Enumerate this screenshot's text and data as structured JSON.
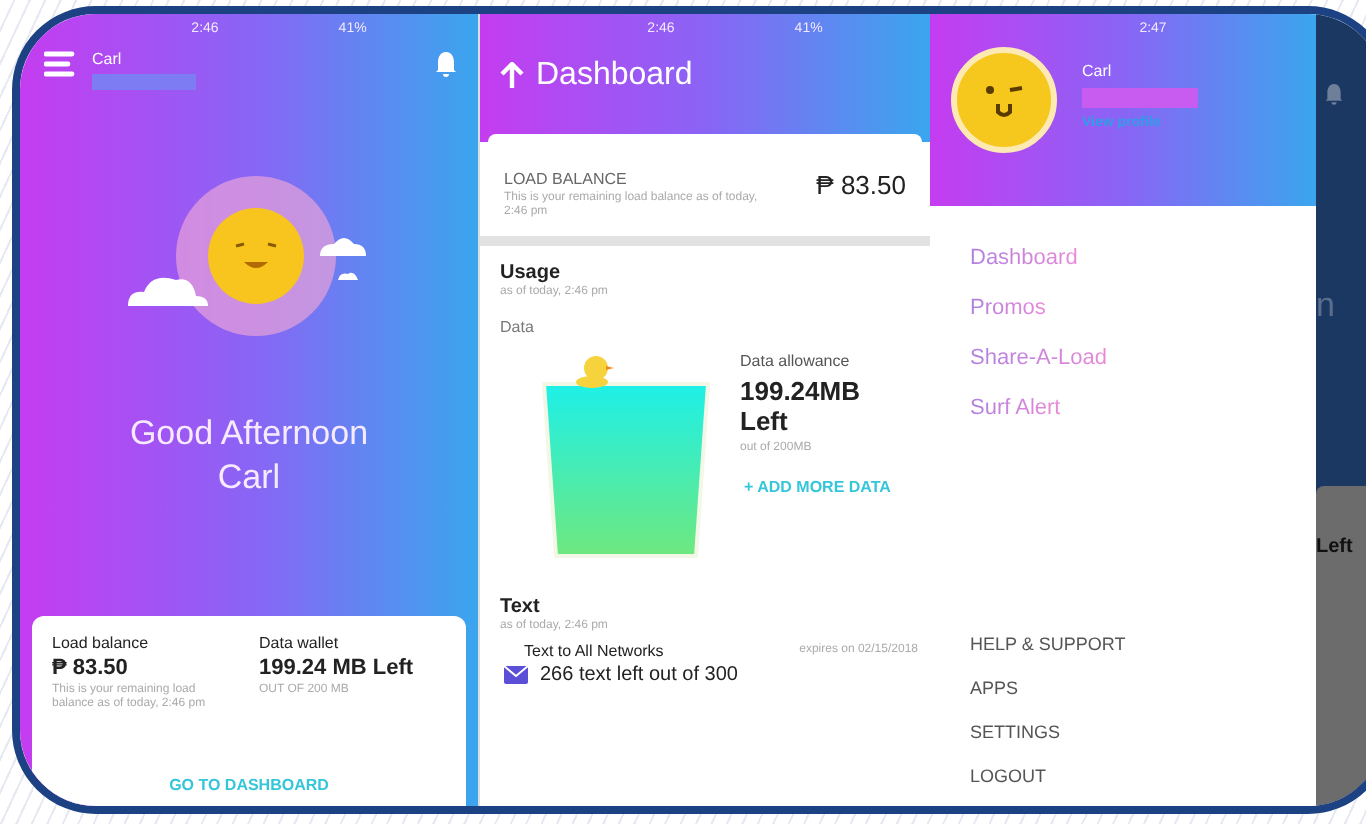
{
  "home": {
    "status": {
      "time": "2:46",
      "battery": "41%"
    },
    "user": "Carl",
    "greeting": [
      "Good Afternoon",
      "Carl"
    ],
    "summary": [
      {
        "label": "Load balance",
        "value": "₱ 83.50",
        "note": "This is your remaining load balance as of today, 2:46 pm"
      },
      {
        "label": "Data wallet",
        "value": "199.24 MB Left",
        "note": "OUT OF 200 MB"
      }
    ],
    "action": "GO TO DASHBOARD"
  },
  "dashboard": {
    "status": {
      "time": "2:46",
      "battery": "41%"
    },
    "title": "Dashboard",
    "balance": {
      "label": "LOAD BALANCE",
      "note": "This is your remaining load balance as of today, 2:46 pm",
      "value": "₱ 83.50"
    },
    "usage": {
      "title": "Usage",
      "note": "as of today, 2:46 pm",
      "data_label": "Data",
      "allowance_label": "Data allowance",
      "allowance_value": "199.24MB Left",
      "allowance_note": "out of 200MB",
      "add_action": "+ ADD MORE DATA"
    },
    "text": {
      "title": "Text",
      "note": "as of today, 2:46 pm",
      "plan": "Text to All Networks",
      "expiry": "expires on 02/15/2018",
      "remaining": "266 text left out of 300"
    }
  },
  "drawer": {
    "status": {
      "time": "2:47"
    },
    "user": "Carl",
    "profile_link": "View profile",
    "menu": [
      "Dashboard",
      "Promos",
      "Share-A-Load",
      "Surf Alert"
    ],
    "footer": [
      "HELP & SUPPORT",
      "APPS",
      "SETTINGS",
      "LOGOUT"
    ],
    "behind": {
      "greeting_fragment": "n",
      "card_fragment": "Left"
    }
  }
}
